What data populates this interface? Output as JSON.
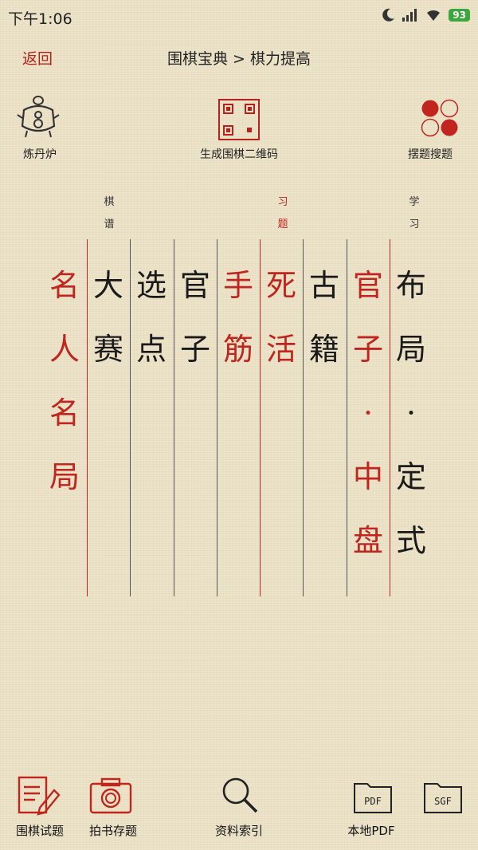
{
  "status": {
    "time": "下午1:06",
    "battery": "93"
  },
  "header": {
    "back_label": "返回",
    "title": "围棋宝典 > 棋力提高"
  },
  "tools": {
    "left_label": "炼丹炉",
    "center_label": "生成围棋二维码",
    "right_label": "摆题搜题"
  },
  "section_labels": {
    "qipu": "棋谱",
    "xiti": "习题",
    "xuexi": "学习"
  },
  "columns": [
    {
      "name": "col-mingren",
      "text": "名人名局",
      "color": "#c0261e"
    },
    {
      "name": "col-dasai",
      "text": "大赛",
      "color": "#1a1a1a"
    },
    {
      "name": "col-xuandian",
      "text": "选点",
      "color": "#1a1a1a"
    },
    {
      "name": "col-guanzi",
      "text": "官子",
      "color": "#1a1a1a"
    },
    {
      "name": "col-shoujin",
      "text": "手筋",
      "color": "#c0261e"
    },
    {
      "name": "col-sihuo",
      "text": "死活",
      "color": "#c0261e"
    },
    {
      "name": "col-guji",
      "text": "古籍",
      "color": "#1a1a1a"
    },
    {
      "name": "col-guanzi-zhongpan",
      "text": "官子·中盘",
      "color": "#c0261e"
    },
    {
      "name": "col-buju-dingshi",
      "text": "布局·定式",
      "color": "#1a1a1a"
    }
  ],
  "bottom": {
    "item1": "围棋试题",
    "item2": "拍书存题",
    "item3": "资料索引",
    "item4": "本地PDF",
    "pdf_icon_text": "PDF",
    "sgf_icon_text": "SGF"
  },
  "colors": {
    "accent_red": "#c0261e",
    "background": "#ece3c9"
  }
}
